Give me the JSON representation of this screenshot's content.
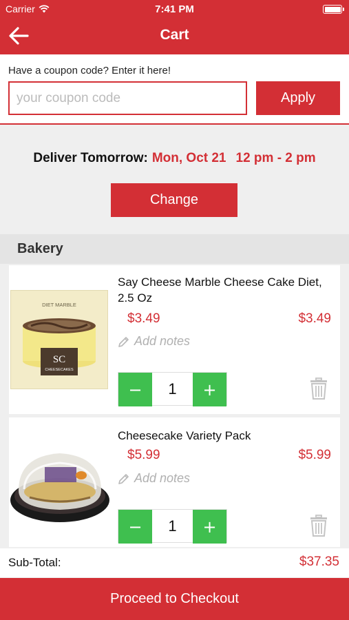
{
  "status_bar": {
    "carrier": "Carrier",
    "time": "7:41 PM"
  },
  "header": {
    "title": "Cart"
  },
  "coupon": {
    "label": "Have a coupon code? Enter it here!",
    "placeholder": "your coupon code",
    "value": "",
    "apply_label": "Apply"
  },
  "delivery": {
    "label": "Deliver Tomorrow:",
    "date": "Mon, Oct 21",
    "time_window": "12 pm - 2 pm",
    "change_label": "Change"
  },
  "section": {
    "title": "Bakery"
  },
  "items": [
    {
      "name": "Say Cheese Marble Cheese Cake Diet, 2.5 Oz",
      "unit_price": "$3.49",
      "total_price": "$3.49",
      "notes_label": "Add notes",
      "quantity": "1",
      "image_text": {
        "top": "DIET MARBLE",
        "logo": "SC",
        "brand": "CHEESECAKES"
      }
    },
    {
      "name": "Cheesecake Variety Pack",
      "unit_price": "$5.99",
      "total_price": "$5.99",
      "notes_label": "Add notes",
      "quantity": "1"
    }
  ],
  "stepper": {
    "minus": "−",
    "plus": "+"
  },
  "footer": {
    "subtotal_label": "Sub-Total:",
    "subtotal_value": "$37.35",
    "checkout_label": "Proceed to Checkout"
  },
  "colors": {
    "brand_red": "#d32f35",
    "stepper_green": "#3fbf4f",
    "background": "#efefef"
  }
}
